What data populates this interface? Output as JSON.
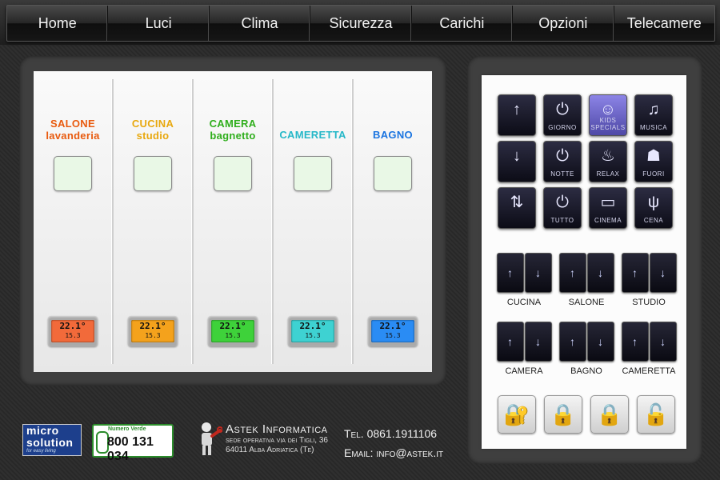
{
  "nav": {
    "items": [
      "Home",
      "Luci",
      "Clima",
      "Sicurezza",
      "Carichi",
      "Opzioni",
      "Telecamere"
    ]
  },
  "zones": [
    {
      "line1": "SALONE",
      "line2": "lavanderia",
      "color1": "#e85a0e",
      "color2": "#e85a0e",
      "lcd_color": "#f26a3a",
      "lcd_temp": "22.1°",
      "lcd_set": "15.3"
    },
    {
      "line1": "CUCINA",
      "line2": "studio",
      "color1": "#e8a80e",
      "color2": "#e8a80e",
      "lcd_color": "#f4a21c",
      "lcd_temp": "22.1°",
      "lcd_set": "15.3"
    },
    {
      "line1": "CAMERA",
      "line2": "bagnetto",
      "color1": "#2fae1c",
      "color2": "#2fae1c",
      "lcd_color": "#3ed23a",
      "lcd_temp": "22.1°",
      "lcd_set": "15.3"
    },
    {
      "line1": "CAMERETTA",
      "line2": "",
      "color1": "#26b8c8",
      "color2": "#26b8c8",
      "lcd_color": "#3ed2d2",
      "lcd_temp": "22.1°",
      "lcd_set": "15.3"
    },
    {
      "line1": "BAGNO",
      "line2": "",
      "color1": "#1a74e0",
      "color2": "#1a74e0",
      "lcd_color": "#2a8cf4",
      "lcd_temp": "22.1°",
      "lcd_set": "15.3"
    }
  ],
  "scenes": [
    {
      "label": "",
      "icon": "blinds-up-icon",
      "sym": "↑"
    },
    {
      "label": "GIORNO",
      "icon": "power-icon",
      "sym": "⏻"
    },
    {
      "label": "KIDS SPECIALS",
      "icon": "kids-face-icon",
      "sym": "☺"
    },
    {
      "label": "MUSICA",
      "icon": "music-icon",
      "sym": "♫"
    },
    {
      "label": "",
      "icon": "blinds-down-icon",
      "sym": "↓"
    },
    {
      "label": "NOTTE",
      "icon": "power-icon",
      "sym": "⏻"
    },
    {
      "label": "RELAX",
      "icon": "relax-icon",
      "sym": "♨"
    },
    {
      "label": "FUORI",
      "icon": "people-icon",
      "sym": "☗"
    },
    {
      "label": "",
      "icon": "blinds-updown-icon",
      "sym": "⇅"
    },
    {
      "label": "TUTTO",
      "icon": "power-icon",
      "sym": "⏻"
    },
    {
      "label": "CINEMA",
      "icon": "tv-icon",
      "sym": "▭"
    },
    {
      "label": "CENA",
      "icon": "cutlery-icon",
      "sym": "ψ"
    }
  ],
  "blinds": [
    "CUCINA",
    "SALONE",
    "STUDIO",
    "CAMERA",
    "BAGNO",
    "CAMERETTA"
  ],
  "locks": [
    {
      "icon": "lock-key-icon",
      "sym": "🔐"
    },
    {
      "icon": "lock-people-icon",
      "sym": "🔒"
    },
    {
      "icon": "lock-sun-icon",
      "sym": "🔒"
    },
    {
      "icon": "unlock-icon",
      "sym": "🔓"
    }
  ],
  "footer": {
    "micro_line1": "micro",
    "micro_line2": "solution",
    "micro_tag": "for easy living",
    "green_label": "Numero Verde",
    "green_number": "800 131 034",
    "company": "Astek Informatica",
    "addr1": "sede operativa via dei Tigli, 36",
    "addr2": "64011 Alba Adriatica (Te)",
    "tel": "Tel. 0861.1911106",
    "email": "Email: info@astek.it"
  }
}
